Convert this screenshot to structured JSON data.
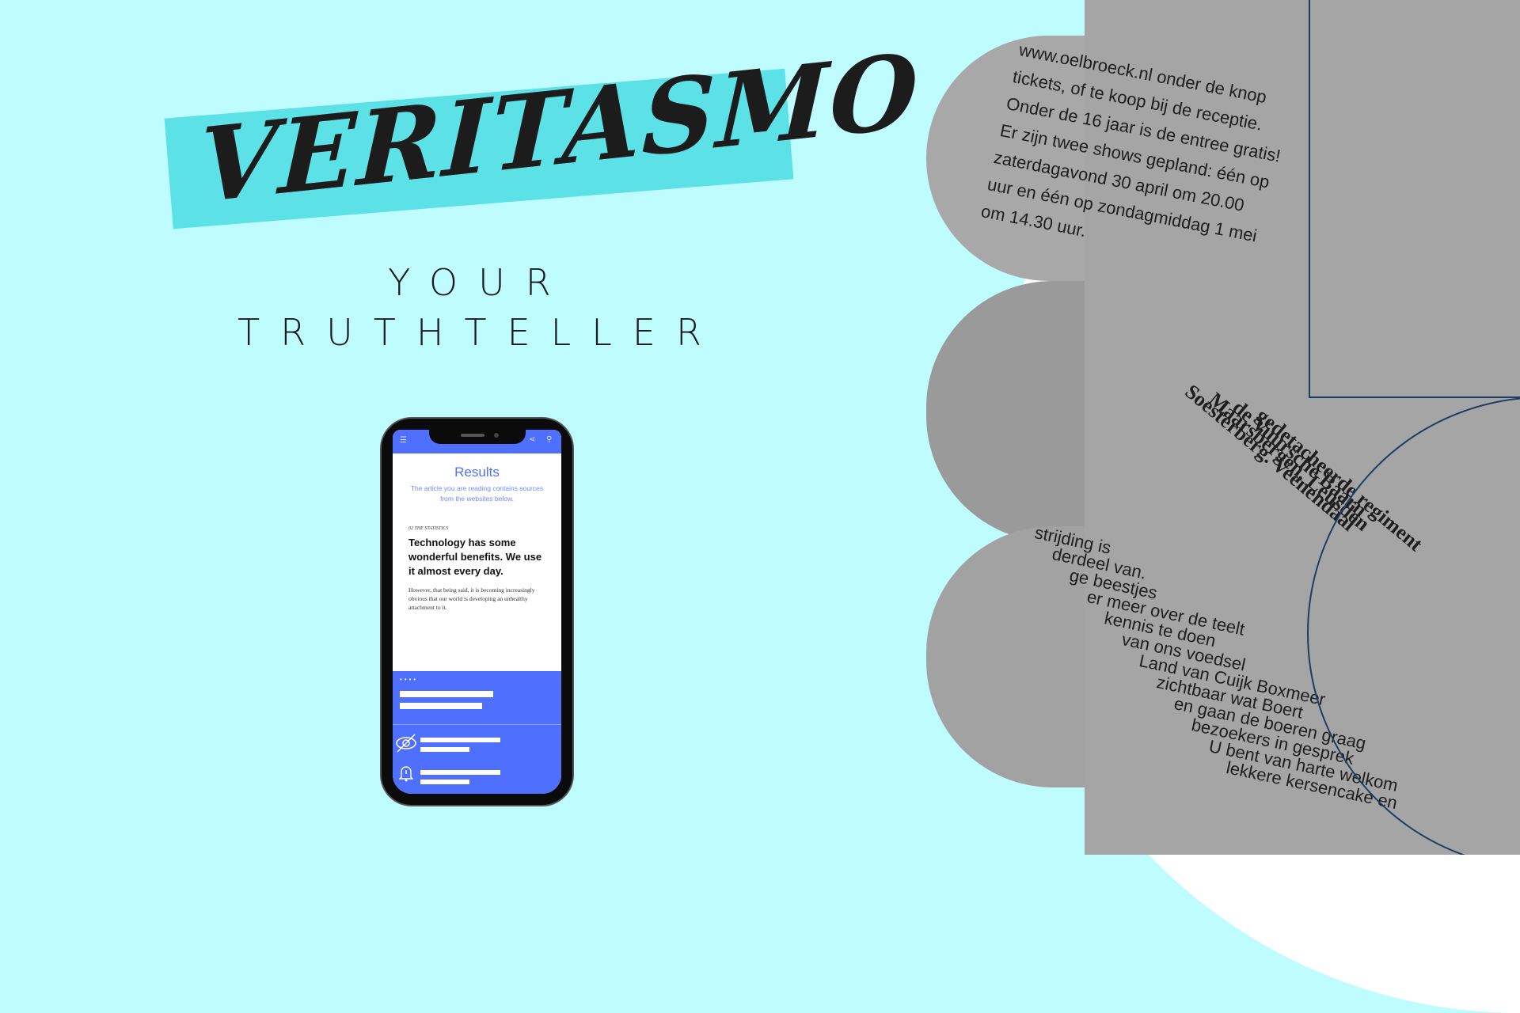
{
  "brand": {
    "logo_text": "VERITASMO",
    "tagline_line1": "YOUR",
    "tagline_line2": "TRUTHTELLER"
  },
  "colors": {
    "background": "#bffcff",
    "banner": "#5ce1e6",
    "app_accent": "#4f6fff",
    "frame_line": "#1d3d63"
  },
  "phone": {
    "title": "Results",
    "description": "The article you are reading contains sources from the websites below.",
    "article": {
      "kicker": "02 The statistics",
      "headline": "Technology has some wonderful benefits. We use it almost every day.",
      "body": "However, that being said, it is becoming increasingly obvious that our world is developing an unhealthy attachment to it."
    },
    "icons": [
      "menu-icon",
      "share-icon",
      "search-icon",
      "eye-slash-icon",
      "bell-icon"
    ],
    "dots": "••••"
  },
  "newspaper": {
    "top": [
      "www.oelbroeck.nl onder de knop",
      "tickets, of te koop bij de receptie.",
      "Onder de 16 jaar is de entree gratis!",
      "Er zijn twee shows gepland: één op",
      "zaterdagavond 30 april om 20.00",
      "uur en één op zondagmiddag 1 mei",
      "om 14.30 uur."
    ],
    "bottom": [
      "Soesterberg. Veenendaal",
      "Maarsbergen, Leusden",
      "de Vuursche Baarn",
      "gedetacheerde regiment",
      "strijding is",
      "derdeel van.",
      "ge beestjes",
      "er meer over de teelt",
      "kennis te doen",
      "van ons voedsel",
      "Land van Cuijk Boxmeer",
      "zichtbaar wat Boert",
      "en gaan de boeren graag",
      "bezoekers in gesprek",
      "U bent van harte welkom",
      "lekkere kersencake en"
    ]
  }
}
